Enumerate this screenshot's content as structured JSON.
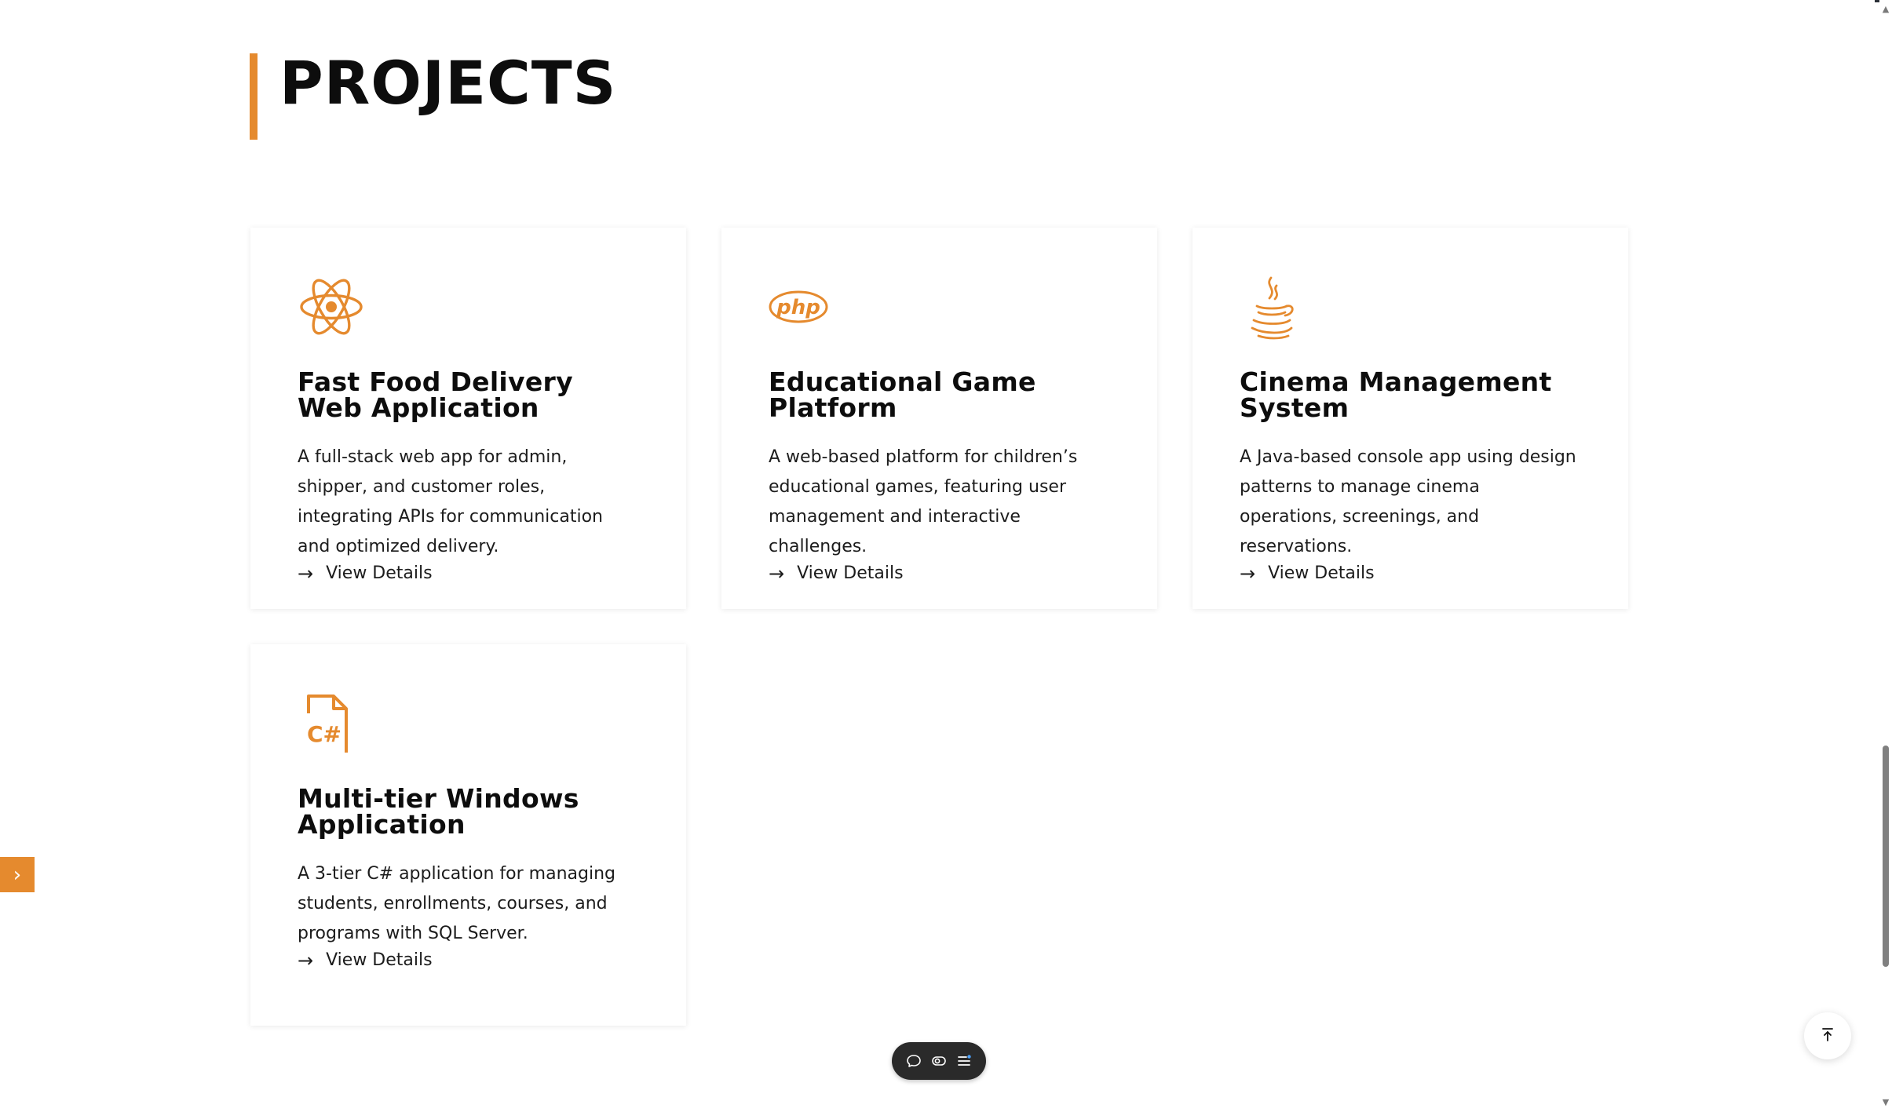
{
  "section": {
    "title": "PROJECTS"
  },
  "projects": [
    {
      "icon": "react-icon",
      "title": "Fast Food Delivery Web Application",
      "description": "A full-stack web app for admin, shipper, and customer roles, integrating APIs for communication and optimized delivery.",
      "link_label": "View Details"
    },
    {
      "icon": "php-icon",
      "title": "Educational Game Platform",
      "description": "A web-based platform for children’s educational games, featuring user management and interactive challenges.",
      "link_label": "View Details"
    },
    {
      "icon": "java-icon",
      "title": "Cinema Management System",
      "description": "A Java-based console app using design patterns to manage cinema operations, screenings, and reservations.",
      "link_label": "View Details"
    },
    {
      "icon": "csharp-file-icon",
      "title": "Multi-tier Windows Application",
      "description": "A 3-tier C# application for managing students, enrollments, courses, and programs with SQL Server.",
      "link_label": "View Details"
    }
  ],
  "side_toggle": {
    "icon": "chevron-right-icon",
    "glyph": "›"
  },
  "bottom_toolbar": {
    "icons": [
      "chat-icon",
      "toggle-icon",
      "menu-icon"
    ]
  },
  "back_to_top": {
    "icon": "arrow-up-to-top-icon"
  },
  "colors": {
    "accent": "#e58a2e",
    "text": "#0d0d0d",
    "toolbar": "#2a2a2a"
  }
}
